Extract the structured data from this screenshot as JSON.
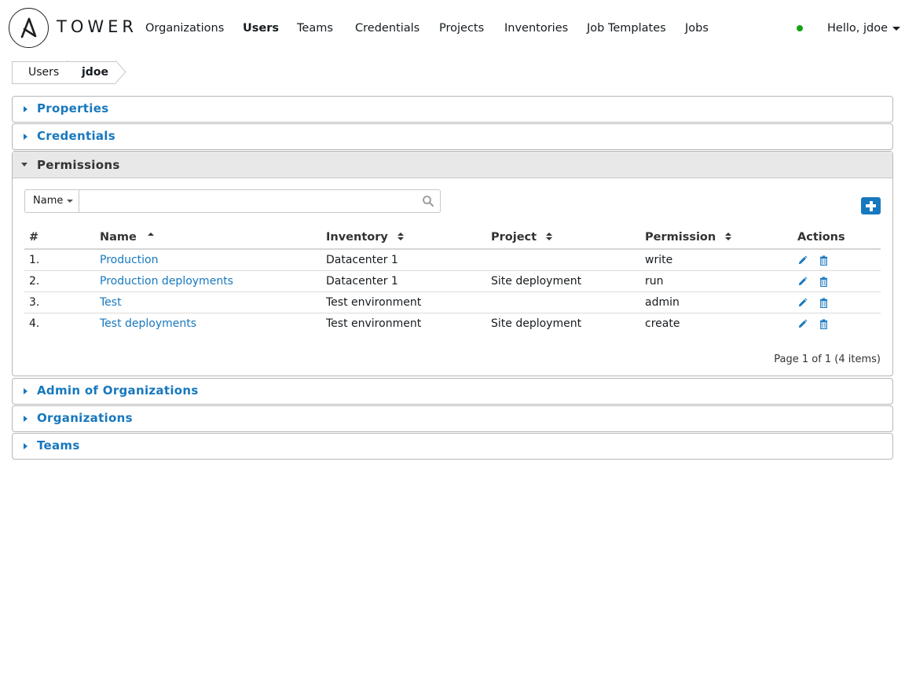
{
  "app": {
    "brand": "TOWER",
    "status_color": "#17a317",
    "accent_color": "#1778be"
  },
  "nav": {
    "items": [
      {
        "label": "Organizations",
        "active": false
      },
      {
        "label": "Users",
        "active": true
      },
      {
        "label": "Teams",
        "active": false
      },
      {
        "label": "Credentials",
        "active": false
      },
      {
        "label": "Projects",
        "active": false
      },
      {
        "label": "Inventories",
        "active": false
      },
      {
        "label": "Job Templates",
        "active": false
      },
      {
        "label": "Jobs",
        "active": false
      }
    ],
    "user_greeting": "Hello, jdoe"
  },
  "breadcrumb": {
    "items": [
      "Users",
      "jdoe"
    ]
  },
  "panels": {
    "properties": {
      "title": "Properties",
      "icon": "caret-right-icon"
    },
    "credentials": {
      "title": "Credentials",
      "icon": "caret-right-icon"
    },
    "permissions": {
      "title": "Permissions",
      "icon": "caret-down-icon"
    },
    "admin_orgs": {
      "title": "Admin of Organizations",
      "icon": "caret-right-icon"
    },
    "organizations": {
      "title": "Organizations",
      "icon": "caret-right-icon"
    },
    "teams": {
      "title": "Teams",
      "icon": "caret-right-icon"
    }
  },
  "permissions": {
    "search": {
      "field": "Name",
      "value": "",
      "placeholder": ""
    },
    "columns": [
      "#",
      "Name",
      "Inventory",
      "Project",
      "Permission",
      "Actions"
    ],
    "rows": [
      {
        "index": "1.",
        "name": "Production",
        "inventory": "Datacenter 1",
        "project": "",
        "permission": "write"
      },
      {
        "index": "2.",
        "name": "Production deployments",
        "inventory": "Datacenter 1",
        "project": "Site deployment",
        "permission": "run"
      },
      {
        "index": "3.",
        "name": "Test",
        "inventory": "Test environment",
        "project": "",
        "permission": "admin"
      },
      {
        "index": "4.",
        "name": "Test deployments",
        "inventory": "Test environment",
        "project": "Site deployment",
        "permission": "create"
      }
    ],
    "pager": "Page 1 of 1 (4 items)"
  }
}
